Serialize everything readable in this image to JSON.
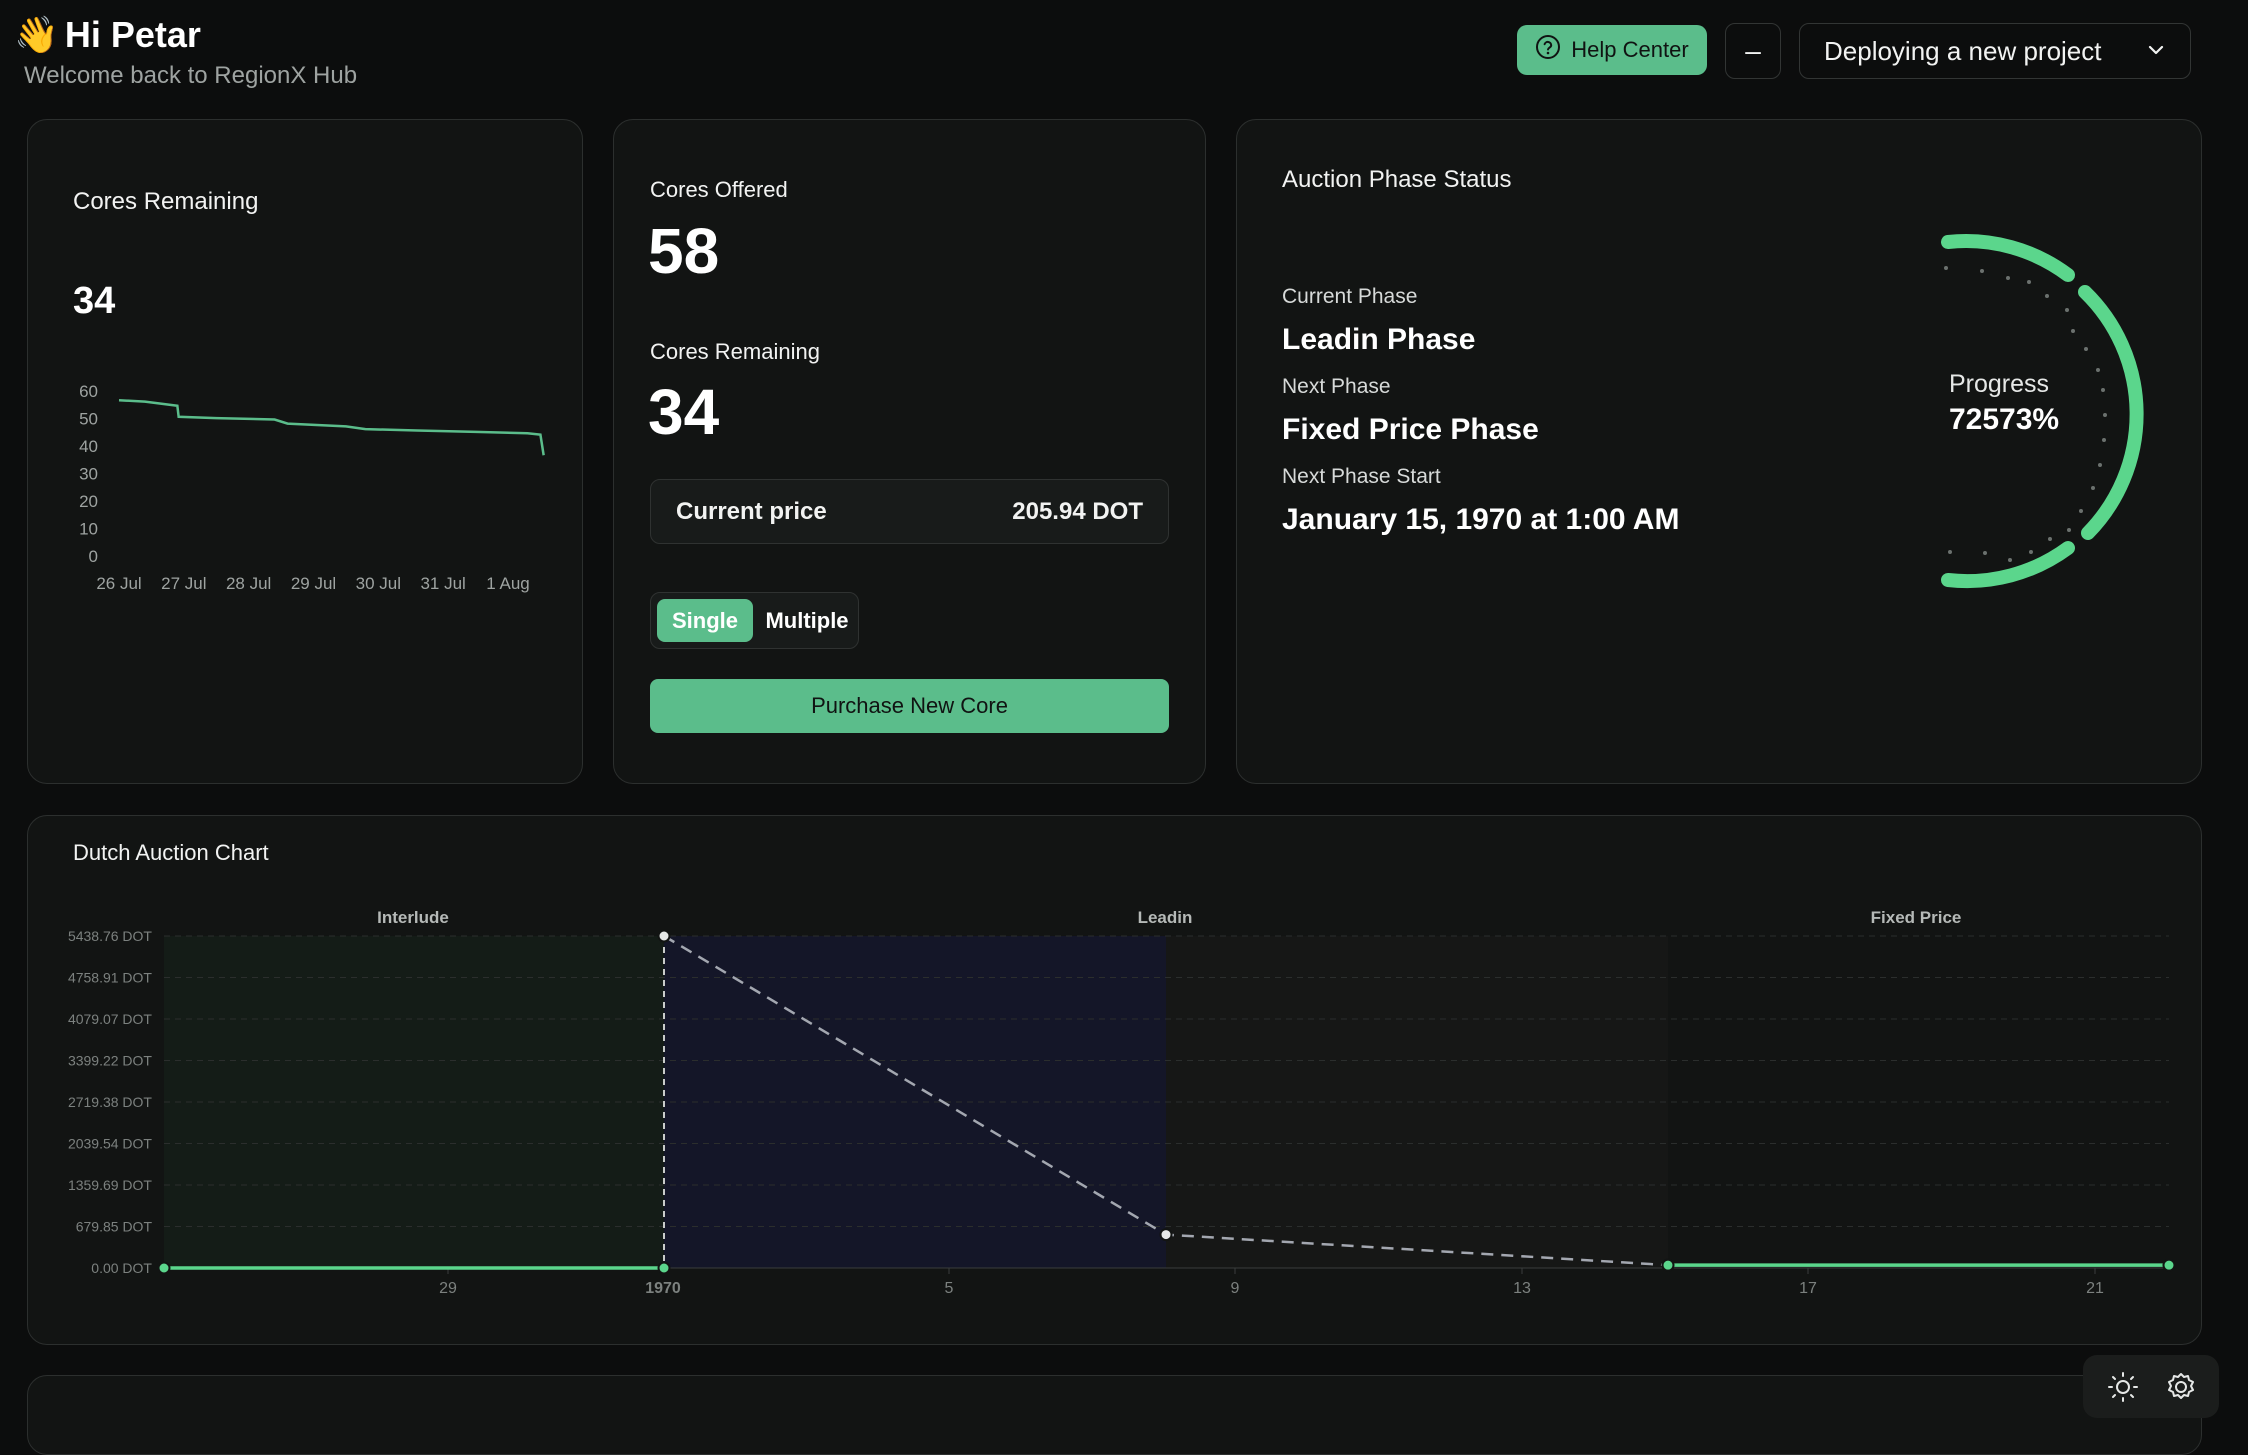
{
  "header": {
    "wave": "👋",
    "greeting": "Hi Petar",
    "welcome": "Welcome back to RegionX Hub",
    "help_label": "Help Center",
    "minus_label": "–",
    "project_selected": "Deploying a new project"
  },
  "cores_card": {
    "title": "Cores Remaining",
    "value": "34",
    "y_ticks": [
      "60",
      "50",
      "40",
      "30",
      "20",
      "10",
      "0"
    ],
    "x_ticks": [
      "26 Jul",
      "27 Jul",
      "28 Jul",
      "29 Jul",
      "30 Jul",
      "31 Jul",
      "1 Aug"
    ]
  },
  "chart_data": [
    {
      "type": "line",
      "x": [
        "26 Jul",
        "27 Jul",
        "28 Jul",
        "29 Jul",
        "30 Jul",
        "31 Jul",
        "1 Aug"
      ],
      "y_ticks": [
        0,
        10,
        20,
        30,
        40,
        50,
        60
      ],
      "series": [
        {
          "points": [
            [
              0,
              57
            ],
            [
              0.4,
              56.5
            ],
            [
              0.9,
              55
            ],
            [
              0.92,
              51
            ],
            [
              1.5,
              50.5
            ],
            [
              2.4,
              50
            ],
            [
              2.6,
              48.5
            ],
            [
              3.5,
              47.5
            ],
            [
              3.8,
              46.5
            ],
            [
              4.6,
              46
            ],
            [
              5.5,
              45.5
            ],
            [
              6.3,
              45
            ],
            [
              6.5,
              44.5
            ],
            [
              6.55,
              37
            ]
          ]
        }
      ],
      "ylim": [
        0,
        60
      ],
      "color": "#5bbd8b"
    },
    {
      "type": "line",
      "title": "Dutch Auction Chart",
      "regions": [
        "Interlude",
        "Leadin",
        "Fixed Price"
      ],
      "y_ticks": [
        "5438.76 DOT",
        "4758.91 DOT",
        "4079.07 DOT",
        "3399.22 DOT",
        "2719.38 DOT",
        "2039.54 DOT",
        "1359.69 DOT",
        "679.85 DOT",
        "0.00 DOT"
      ],
      "x_ticks": [
        "29",
        "1970",
        "5",
        "9",
        "13",
        "17",
        "21"
      ],
      "ylim": [
        0,
        5438.76
      ],
      "series": [
        {
          "name": "",
          "points": [
            [
              0,
              0
            ],
            [
              1,
              0
            ]
          ],
          "color": "#5bd68c",
          "region": "Interlude"
        },
        {
          "name": "",
          "points": [
            [
              1,
              5438.76
            ],
            [
              2,
              547
            ],
            [
              3,
              47
            ]
          ],
          "color": "#a3a7b0",
          "dashed": true,
          "region": "Leadin"
        },
        {
          "name": "",
          "points": [
            [
              3,
              47
            ],
            [
              4,
              47
            ]
          ],
          "color": "#5bd68c",
          "region": "Fixed Price"
        }
      ]
    }
  ],
  "offered_card": {
    "offered_label": "Cores Offered",
    "offered_value": "58",
    "remaining_label": "Cores Remaining",
    "remaining_value": "34",
    "price_label": "Current price",
    "price_value": "205.94 DOT",
    "toggle_single": "Single",
    "toggle_multiple": "Multiple",
    "purchase_label": "Purchase New Core"
  },
  "phase_card": {
    "title": "Auction Phase Status",
    "current_label": "Current Phase",
    "current_value": "Leadin Phase",
    "next_label": "Next Phase",
    "next_value": "Fixed Price Phase",
    "start_label": "Next Phase Start",
    "start_value": "January 15, 1970 at 1:00 AM",
    "progress_label": "Progress",
    "progress_value": "72573%"
  },
  "colors": {
    "accent": "#5bbd8b",
    "progress": "#5bd68c",
    "interlude_bg": "#141c17",
    "leadin_bg": "#141628",
    "fixed_bg": "#161716"
  },
  "icons": [
    "wave-emoji",
    "help-circle-icon",
    "chevron-down-icon",
    "sun-icon",
    "settings-gear-icon"
  ]
}
